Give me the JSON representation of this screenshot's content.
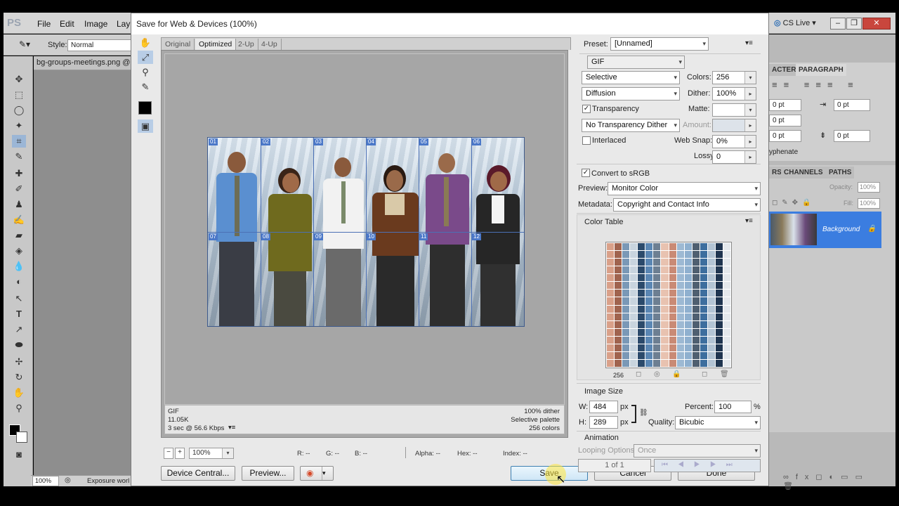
{
  "photoshop": {
    "logo": "PS",
    "menus": [
      "File",
      "Edit",
      "Image",
      "Lay"
    ],
    "options_bar": {
      "style_label": "Style:",
      "style_value": "Normal"
    },
    "doc_tab": "bg-groups-meetings.png @",
    "status_zoom": "100%",
    "status_text": "Exposure worl",
    "cs_live": "CS Live",
    "right_panel": {
      "tab_character": "ACTER",
      "tab_paragraph": "PARAGRAPH",
      "indent_fields": [
        "0 pt",
        "0 pt",
        "0 pt",
        "0 pt",
        "0 pt"
      ],
      "hyphenate": "yphenate",
      "tab_layers": "RS",
      "tab_channels": "CHANNELS",
      "tab_paths": "PATHS",
      "opacity_label": "Opacity:",
      "opacity_value": "100%",
      "fill_label": "Fill:",
      "fill_value": "100%",
      "layer_name": "Background"
    }
  },
  "dialog": {
    "title": "Save for Web & Devices (100%)",
    "view_tabs": [
      "Original",
      "Optimized",
      "2-Up",
      "4-Up"
    ],
    "active_tab": "Optimized",
    "slices": [
      "01",
      "02",
      "03",
      "04",
      "05",
      "06",
      "07",
      "08",
      "09",
      "10",
      "11",
      "12"
    ],
    "info_left": {
      "format": "GIF",
      "size": "11.05K",
      "time": "3 sec @ 56.6 Kbps"
    },
    "info_right": {
      "dither": "100% dither",
      "palette": "Selective palette",
      "colors": "256 colors"
    },
    "zoom_value": "100%",
    "readouts": {
      "r": "R: --",
      "g": "G: --",
      "b": "B: --",
      "alpha": "Alpha: --",
      "hex": "Hex: --",
      "index": "Index: --"
    },
    "buttons": {
      "device_central": "Device Central...",
      "preview": "Preview...",
      "save": "Save",
      "cancel": "Cancel",
      "done": "Done"
    },
    "settings": {
      "preset_label": "Preset:",
      "preset_value": "[Unnamed]",
      "format": "GIF",
      "reduction": "Selective",
      "colors_label": "Colors:",
      "colors_value": "256",
      "dither_algo": "Diffusion",
      "dither_label": "Dither:",
      "dither_value": "100%",
      "transparency_label": "Transparency",
      "transparency_checked": true,
      "matte_label": "Matte:",
      "transp_dither": "No Transparency Dither",
      "amount_label": "Amount:",
      "interlaced_label": "Interlaced",
      "interlaced_checked": false,
      "websnap_label": "Web Snap:",
      "websnap_value": "0%",
      "lossy_label": "Lossy:",
      "lossy_value": "0",
      "srgb_label": "Convert to sRGB",
      "srgb_checked": true,
      "preview_label": "Preview:",
      "preview_value": "Monitor Color",
      "metadata_label": "Metadata:",
      "metadata_value": "Copyright and Contact Info",
      "color_table_label": "Color Table",
      "color_count": "256",
      "image_size_label": "Image Size",
      "w_label": "W:",
      "w_value": "484",
      "h_label": "H:",
      "h_value": "289",
      "px": "px",
      "percent_label": "Percent:",
      "percent_value": "100",
      "percent_sign": "%",
      "quality_label": "Quality:",
      "quality_value": "Bicubic",
      "animation_label": "Animation",
      "looping_label": "Looping Options:",
      "looping_value": "Once",
      "frame_counter": "1 of 1"
    },
    "palette_colors": [
      "#2b4a6b",
      "#5a86b3",
      "#8fb0cf",
      "#c8d4de",
      "#d9a089",
      "#a0634e",
      "#6d7f92",
      "#e4e8ec",
      "#3d6e9e",
      "#b3c4d4",
      "#7a98b6",
      "#4f5f70",
      "#c98a75",
      "#9db9d3",
      "#1f3550",
      "#e8c2b0"
    ]
  }
}
